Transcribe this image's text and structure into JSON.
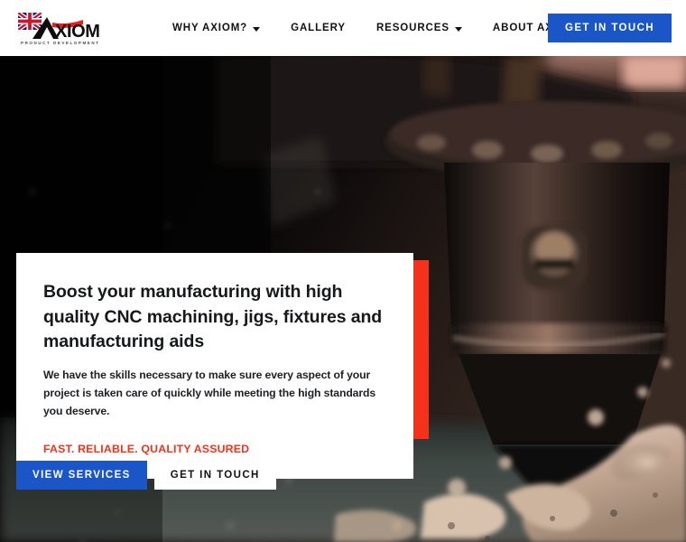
{
  "header": {
    "logo": {
      "name": "axiom-logo",
      "wordmark": "AXIOM",
      "tagline": "PRODUCT DEVELOPMENT",
      "flag": "union-jack"
    },
    "nav": [
      {
        "label": "WHY AXIOM?",
        "has_dropdown": true,
        "name": "why-axiom"
      },
      {
        "label": "GALLERY",
        "has_dropdown": false,
        "name": "gallery"
      },
      {
        "label": "RESOURCES",
        "has_dropdown": true,
        "name": "resources"
      },
      {
        "label": "ABOUT AXIOM",
        "has_dropdown": false,
        "name": "about-axiom"
      }
    ],
    "cta_label": "GET IN TOUCH"
  },
  "hero": {
    "image_description": "Close-up of a CNC machine spindle and tool holder with coolant splashing",
    "card": {
      "heading": "Boost your manufacturing with high quality CNC machining, jigs, fixtures and manufacturing aids",
      "body": "We have the skills necessary to make sure every aspect of your project is taken care of quickly while meeting the high standards you deserve.",
      "tagline": "FAST. RELIABLE. QUALITY ASSURED"
    },
    "buttons": {
      "primary_label": "VIEW SERVICES",
      "secondary_label": "GET IN TOUCH"
    }
  },
  "colors": {
    "brand_blue": "#1a56c8",
    "brand_red": "#f4311b",
    "header_bg": "#ffffff",
    "card_bg": "#ffffff",
    "text_dark": "#16181c"
  }
}
